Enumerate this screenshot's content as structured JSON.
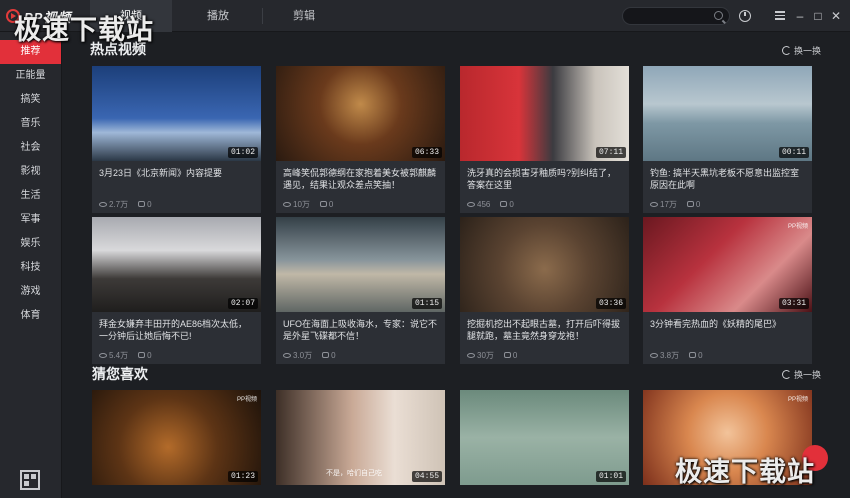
{
  "app": {
    "logo_text": "PP视频"
  },
  "tabs": [
    {
      "label": "视频"
    },
    {
      "label": "播放"
    },
    {
      "label": "剪辑"
    }
  ],
  "search": {
    "placeholder": ""
  },
  "sidebar": {
    "items": [
      {
        "label": "推荐"
      },
      {
        "label": "正能量"
      },
      {
        "label": "搞笑"
      },
      {
        "label": "音乐"
      },
      {
        "label": "社会"
      },
      {
        "label": "影视"
      },
      {
        "label": "生活"
      },
      {
        "label": "军事"
      },
      {
        "label": "娱乐"
      },
      {
        "label": "科技"
      },
      {
        "label": "游戏"
      },
      {
        "label": "体育"
      }
    ]
  },
  "sections": [
    {
      "title": "热点视频",
      "refresh": "换一换"
    },
    {
      "title": "猜您喜欢",
      "refresh": "换一换"
    }
  ],
  "cards": [
    {
      "title": "3月23日《北京新闻》内容提要",
      "duration": "01:02",
      "views": "2.7万",
      "comments": "0"
    },
    {
      "title": "高峰笑侃郭德纲在家抱着美女被郭麒麟遇见，结果让观众差点笑抽！",
      "duration": "06:33",
      "views": "10万",
      "comments": "0"
    },
    {
      "title": "洗牙真的会损害牙釉质吗?别纠结了，答案在这里",
      "duration": "07:11",
      "views": "456",
      "comments": "0"
    },
    {
      "title": "钓鱼: 搞半天黑坑老板不愿意出监控室原因在此啊",
      "duration": "00:11",
      "views": "17万",
      "comments": "0"
    },
    {
      "title": "拜金女嫌弃丰田开的AE86档次太低，一分钟后让她后悔不已!",
      "duration": "02:07",
      "views": "5.4万",
      "comments": "0"
    },
    {
      "title": "UFO在海面上吸收海水，专家：说它不是外星飞碟都不信！",
      "duration": "01:15",
      "views": "3.0万",
      "comments": "0"
    },
    {
      "title": "挖掘机挖出不起眼古墓，打开后吓得拔腿就跑，墓主竟然身穿龙袍！",
      "duration": "03:36",
      "views": "30万",
      "comments": "0"
    },
    {
      "title": "3分钟看完热血的《妖精的尾巴》",
      "duration": "03:31",
      "views": "3.8万",
      "comments": "0"
    },
    {
      "title": "",
      "duration": "01:23",
      "views": "",
      "comments": ""
    },
    {
      "title": "",
      "duration": "04:55",
      "views": "",
      "comments": ""
    },
    {
      "title": "",
      "duration": "01:01",
      "views": "",
      "comments": ""
    },
    {
      "title": "",
      "duration": "",
      "views": "",
      "comments": ""
    }
  ],
  "thumb_labels": {
    "card2_overlay": "PP视频",
    "card8_brand": "PP视频",
    "card9_brand": "PP视频",
    "card12_brand": "PP视频",
    "card10_subtitle": "不是，哈们自己吃"
  },
  "watermark": {
    "top": "极速下载站",
    "bottom": "极速下载站"
  },
  "colors": {
    "accent": "#e2303a",
    "background": "#1d1f23",
    "panel": "#26282d"
  }
}
